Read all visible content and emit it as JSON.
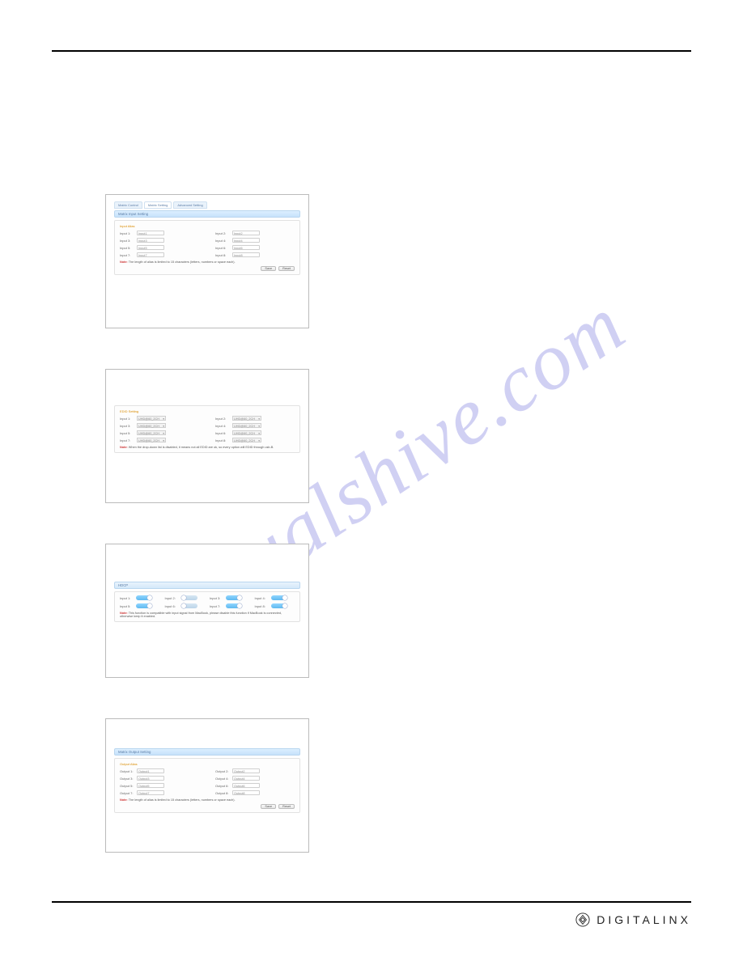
{
  "watermark": "manualshive.com",
  "brand": {
    "text": "DIGITALINX"
  },
  "figures": {
    "input_alias": {
      "tabs": [
        "Matrix Control",
        "Matrix Setting",
        "Advanced Setting"
      ],
      "panel_title": "Matrix Input Setting",
      "section": "Input Alias",
      "left": [
        {
          "label": "Input 1:",
          "value": "Input1"
        },
        {
          "label": "Input 3:",
          "value": "Input3"
        },
        {
          "label": "Input 5:",
          "value": "Input5"
        },
        {
          "label": "Input 7:",
          "value": "Input7"
        }
      ],
      "right": [
        {
          "label": "Input 2:",
          "value": "Input2"
        },
        {
          "label": "Input 4:",
          "value": "Input4"
        },
        {
          "label": "Input 6:",
          "value": "Input6"
        },
        {
          "label": "Input 8:",
          "value": "Input8"
        }
      ],
      "note_key": "Note:",
      "note": "The length of alias is limited to 15 characters (letters, numbers or space each).",
      "buttons": [
        "Save",
        "Reset"
      ]
    },
    "edid": {
      "section": "EDID Setting",
      "left": [
        {
          "label": "Input 1:",
          "value": "UHD@60_2CH"
        },
        {
          "label": "Input 3:",
          "value": "UHD@60_2CH"
        },
        {
          "label": "Input 5:",
          "value": "UHD@60_2CH"
        },
        {
          "label": "Input 7:",
          "value": "UHD@60_2CH"
        }
      ],
      "right": [
        {
          "label": "Input 2:",
          "value": "UHD@60_2CH"
        },
        {
          "label": "Input 4:",
          "value": "UHD@60_2CH"
        },
        {
          "label": "Input 6:",
          "value": "UHD@60_2CH"
        },
        {
          "label": "Input 8:",
          "value": "UHD@60_2CH"
        }
      ],
      "note_key": "Note:",
      "note": "When the drop-down list is disabled, it means not all EDID are ok, so every option will EDID through usb-B."
    },
    "hdcp": {
      "section": "HDCP",
      "row1": [
        {
          "label": "Input 1:",
          "state": "Enable"
        },
        {
          "label": "Input 2:",
          "state": "Enable"
        },
        {
          "label": "Input 3:",
          "state": "Enable"
        },
        {
          "label": "Input 4:",
          "state": "Enable"
        }
      ],
      "row2": [
        {
          "label": "Input 5:",
          "state": "Enable"
        },
        {
          "label": "Input 6:",
          "state": "Enable"
        },
        {
          "label": "Input 7:",
          "state": "Enable"
        },
        {
          "label": "Input 8:",
          "state": "Enable"
        }
      ],
      "note_key": "Note:",
      "note": "This function is compatible with input signal from MacBook, please disable this function if MacBook is connected, otherwise keep it enabled."
    },
    "output_alias": {
      "panel_title": "Matrix Output Setting",
      "section": "Output Alias",
      "left": [
        {
          "label": "Output 1:",
          "value": "Output1"
        },
        {
          "label": "Output 3:",
          "value": "Output3"
        },
        {
          "label": "Output 5:",
          "value": "Output5"
        },
        {
          "label": "Output 7:",
          "value": "Output7"
        }
      ],
      "right": [
        {
          "label": "Output 2:",
          "value": "Output2"
        },
        {
          "label": "Output 4:",
          "value": "Output4"
        },
        {
          "label": "Output 6:",
          "value": "Output6"
        },
        {
          "label": "Output 8:",
          "value": "Output8"
        }
      ],
      "note_key": "Note:",
      "note": "The length of alias is limited to 15 characters (letters, numbers or space each).",
      "buttons": [
        "Save",
        "Reset"
      ]
    }
  }
}
